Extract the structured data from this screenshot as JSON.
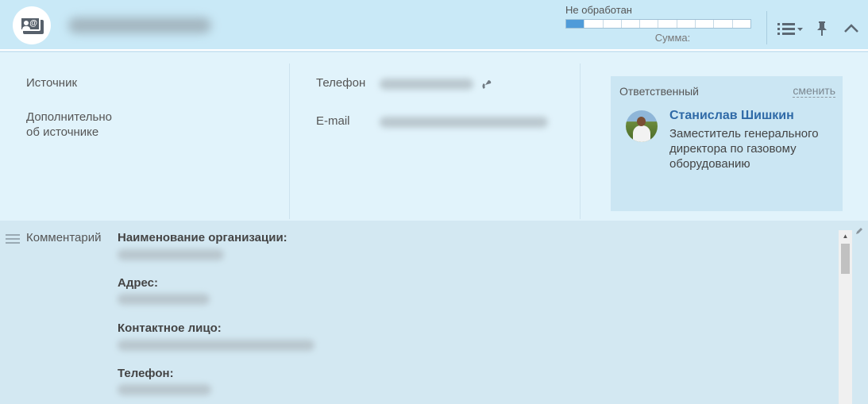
{
  "header": {
    "status_label": "Не обработан",
    "sum_label": "Сумма:",
    "progress_segments": 10,
    "progress_filled": 1,
    "colors": {
      "header_bg": "#c9e9f7",
      "progress_fill": "#4f9bd9"
    },
    "icons": {
      "entity": "contact-card-icon",
      "list": "list-menu-icon",
      "pin": "pin-icon",
      "collapse": "chevron-up-icon"
    }
  },
  "info": {
    "source_label": "Источник",
    "source_extra_label": "Дополнительно\nоб источнике",
    "phone_label": "Телефон",
    "email_label": "E-mail",
    "phone_icon": "phone-call-icon"
  },
  "responsible": {
    "title": "Ответственный",
    "change_label": "сменить",
    "name": "Станислав Шишкин",
    "position": "Заместитель генерального директора по газовому оборудованию"
  },
  "comment": {
    "label": "Комментарий",
    "fields": [
      "Наименование организации:",
      "Адрес:",
      "Контактное лицо:",
      "Телефон:"
    ],
    "icons": {
      "drag": "drag-handle-icon",
      "edit": "pencil-icon"
    }
  }
}
